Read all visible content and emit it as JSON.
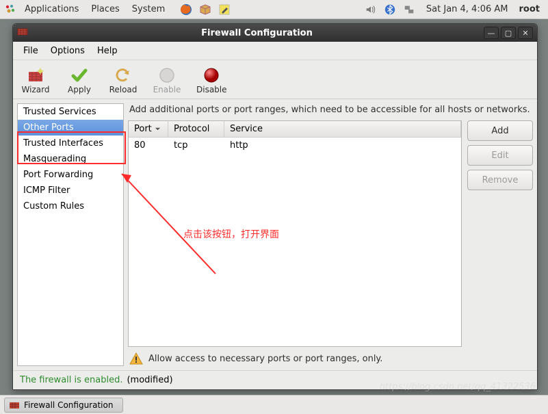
{
  "panel": {
    "apps": "Applications",
    "places": "Places",
    "system": "System",
    "clock": "Sat Jan  4,  4:06 AM",
    "user": "root"
  },
  "window": {
    "title": "Firewall Configuration",
    "menus": {
      "file": "File",
      "options": "Options",
      "help": "Help"
    },
    "toolbar": {
      "wizard": "Wizard",
      "apply": "Apply",
      "reload": "Reload",
      "enable": "Enable",
      "disable": "Disable"
    },
    "sidebar": {
      "items": [
        "Trusted Services",
        "Other Ports",
        "Trusted Interfaces",
        "Masquerading",
        "Port Forwarding",
        "ICMP Filter",
        "Custom Rules"
      ],
      "selected_index": 1
    },
    "desc": "Add additional ports or port ranges, which need to be accessible for all hosts or networks.",
    "table": {
      "headers": {
        "port": "Port",
        "protocol": "Protocol",
        "service": "Service"
      },
      "rows": [
        {
          "port": "80",
          "protocol": "tcp",
          "service": "http"
        }
      ]
    },
    "buttons": {
      "add": "Add",
      "edit": "Edit",
      "remove": "Remove"
    },
    "hint": "Allow access to necessary ports or port ranges, only.",
    "status": {
      "enabled": "The firewall is enabled.",
      "modified": "(modified)"
    }
  },
  "taskbar": {
    "item": "Firewall Configuration"
  },
  "annotation": "点击该按钮，打开界面",
  "watermark": "https://blog.csdn.net/qq_41322536"
}
